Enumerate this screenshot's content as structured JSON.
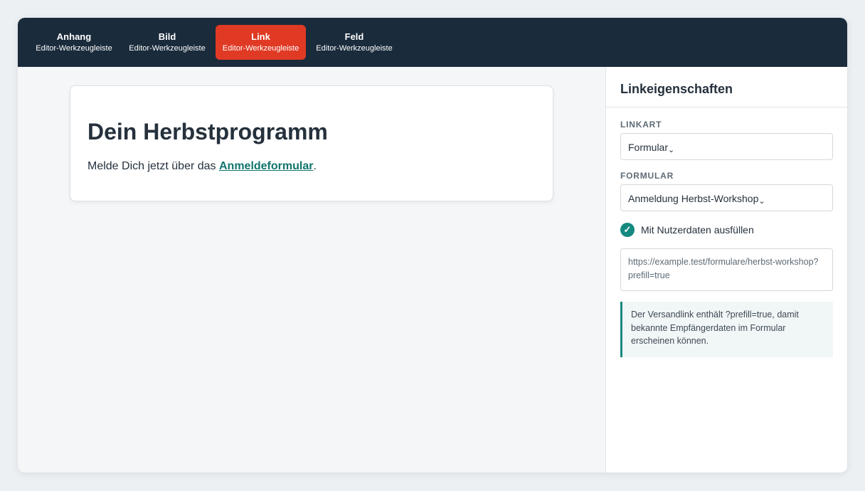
{
  "toolbar": {
    "tabs": [
      {
        "label": "Anhang",
        "sublabel": "Editor-Werkzeugleiste",
        "active": false
      },
      {
        "label": "Bild",
        "sublabel": "Editor-Werkzeugleiste",
        "active": false
      },
      {
        "label": "Link",
        "sublabel": "Editor-Werkzeugleiste",
        "active": true
      },
      {
        "label": "Feld",
        "sublabel": "Editor-Werkzeugleiste",
        "active": false
      }
    ]
  },
  "canvas": {
    "heading": "Dein Herbstprogramm",
    "text_before": "Melde Dich jetzt über das ",
    "link_text": "Anmeldeformular",
    "text_after": "."
  },
  "panel": {
    "title": "Linkeigenschaften",
    "link_type_label": "LINKART",
    "link_type_value": "Formular",
    "form_label": "FORMULAR",
    "form_value": "Anmeldung Herbst-Workshop",
    "prefill_checked": true,
    "prefill_label": "Mit Nutzerdaten ausfüllen",
    "url": "https://example.test/formulare/herbst-workshop?prefill=true",
    "note": "Der Versandlink enthält ?prefill=true, damit bekannte Empfängerdaten im Formular erscheinen können."
  },
  "icons": {
    "chevron": "chevron-down-icon",
    "check": "check-icon"
  },
  "colors": {
    "toolbar_bg": "#1a2b3b",
    "active_tab": "#e03a24",
    "accent": "#14897f",
    "link": "#10756d"
  }
}
